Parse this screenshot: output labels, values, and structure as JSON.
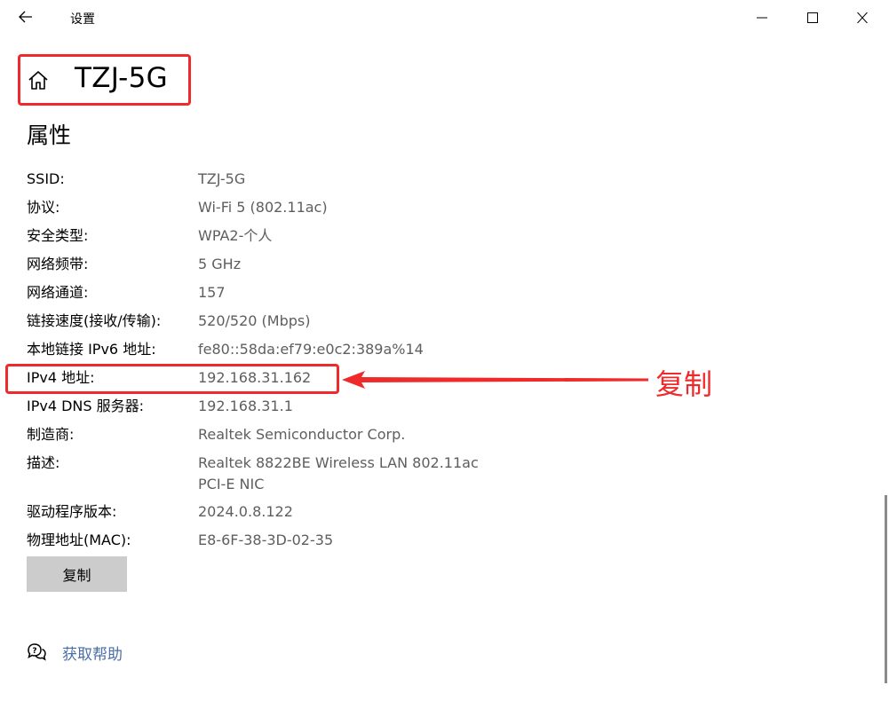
{
  "window": {
    "title": "设置",
    "back_icon": "arrow-left-icon",
    "minimize_icon": "minimize-icon",
    "maximize_icon": "maximize-icon",
    "close_icon": "close-icon"
  },
  "header": {
    "home_icon": "home-icon",
    "network_name": "TZJ-5G"
  },
  "section": {
    "title": "属性"
  },
  "properties": [
    {
      "label": "SSID:",
      "value": "TZJ-5G"
    },
    {
      "label": "协议:",
      "value": "Wi-Fi 5 (802.11ac)"
    },
    {
      "label": "安全类型:",
      "value": "WPA2-个人"
    },
    {
      "label": "网络频带:",
      "value": "5 GHz"
    },
    {
      "label": "网络通道:",
      "value": "157"
    },
    {
      "label": "链接速度(接收/传输):",
      "value": "520/520 (Mbps)"
    },
    {
      "label": "本地链接 IPv6 地址:",
      "value": "fe80::58da:ef79:e0c2:389a%14"
    },
    {
      "label": "IPv4 地址:",
      "value": "192.168.31.162"
    },
    {
      "label": "IPv4 DNS 服务器:",
      "value": "192.168.31.1"
    },
    {
      "label": "制造商:",
      "value": "Realtek Semiconductor Corp."
    },
    {
      "label": "描述:",
      "value": "Realtek 8822BE Wireless LAN 802.11ac PCI-E NIC"
    },
    {
      "label": "驱动程序版本:",
      "value": "2024.0.8.122"
    },
    {
      "label": "物理地址(MAC):",
      "value": "E8-6F-38-3D-02-35"
    }
  ],
  "copy_button": {
    "label": "复制"
  },
  "help": {
    "icon": "chat-help-icon",
    "label": "获取帮助"
  },
  "annotation": {
    "text": "复制",
    "color": "#ee2a2a"
  },
  "colors": {
    "value_text": "#5e5e5e",
    "link": "#4a6fa5",
    "button_bg": "#cccccc"
  }
}
